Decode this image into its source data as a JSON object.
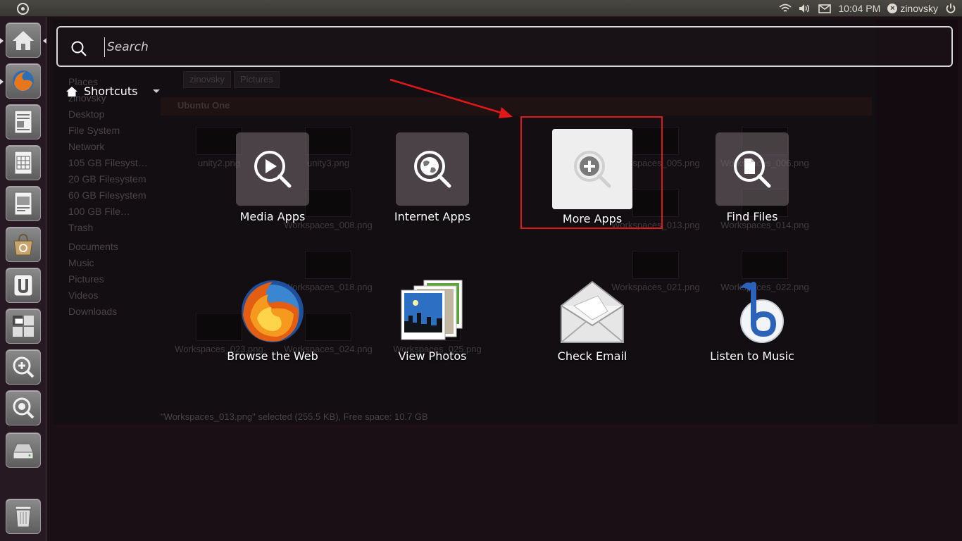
{
  "panel": {
    "time": "10:04 PM",
    "user": "zinovsky"
  },
  "background_window": {
    "places_header": "Places",
    "sidebar": [
      "zinovsky",
      "Desktop",
      "File System",
      "Network",
      "105 GB Filesyst…",
      "20 GB Filesystem",
      "60 GB Filesystem",
      "100 GB File…",
      "Trash",
      "Documents",
      "Music",
      "Pictures",
      "Videos",
      "Downloads"
    ],
    "breadcrumbs": [
      "zinovsky",
      "Pictures"
    ],
    "banner": "Ubuntu One",
    "files": [
      "unity2.png",
      "unity3.png",
      "Workspaces_008.png",
      "Workspaces_018.png",
      "Workspaces_023.png",
      "Workspaces_024.png",
      "Workspaces_025.png",
      "Workspaces_005.png",
      "Workspaces_006.png",
      "Workspaces_013.png",
      "Workspaces_014.png",
      "Workspaces_021.png",
      "Workspaces_022.png"
    ],
    "status": "\"Workspaces_013.png\" selected (255.5 KB), Free space: 10.7 GB"
  },
  "dash": {
    "search_placeholder": "Search",
    "shortcuts_label": "Shortcuts",
    "tiles": [
      {
        "label": "Media Apps",
        "icon": "media-apps-icon"
      },
      {
        "label": "Internet Apps",
        "icon": "internet-apps-icon"
      },
      {
        "label": "More Apps",
        "icon": "more-apps-icon"
      },
      {
        "label": "Find Files",
        "icon": "find-files-icon"
      },
      {
        "label": "Browse the Web",
        "icon": "firefox-icon"
      },
      {
        "label": "View Photos",
        "icon": "photos-icon"
      },
      {
        "label": "Check Email",
        "icon": "email-icon"
      },
      {
        "label": "Listen to Music",
        "icon": "music-icon"
      }
    ]
  },
  "colors": {
    "highlight": "#e21818",
    "panel": "#3c3b37",
    "launcher": "#281a22"
  }
}
